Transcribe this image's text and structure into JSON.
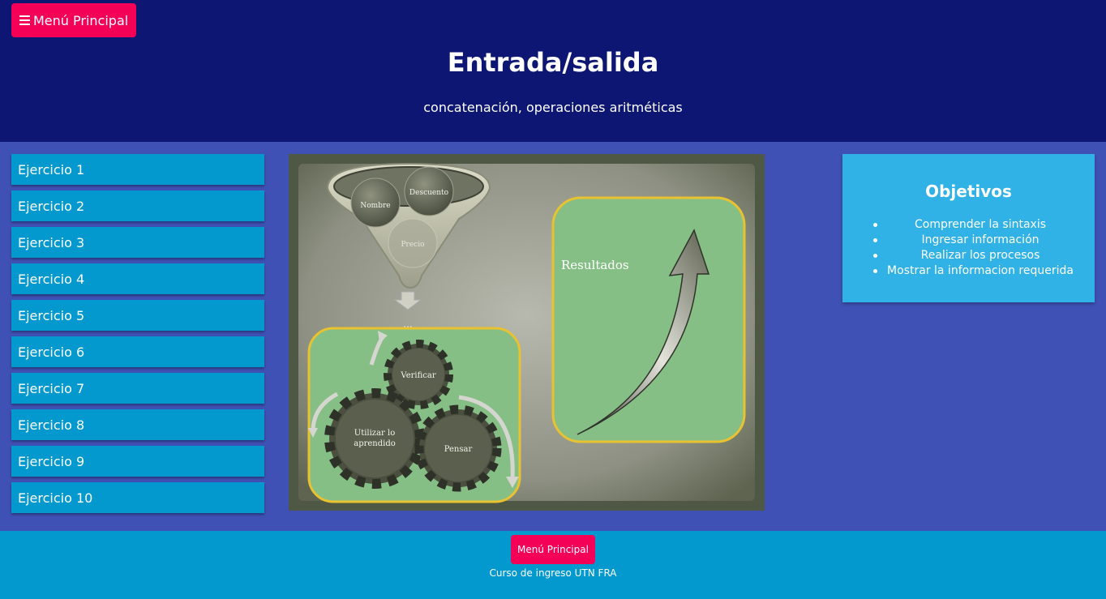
{
  "header": {
    "menu_label": "Menú Principal",
    "title": "Entrada/salida",
    "subtitle": "concatenación, operaciones aritméticas"
  },
  "sidebar": {
    "items": [
      {
        "label": "Ejercicio 1"
      },
      {
        "label": "Ejercicio 2"
      },
      {
        "label": "Ejercicio 3"
      },
      {
        "label": "Ejercicio 4"
      },
      {
        "label": "Ejercicio 5"
      },
      {
        "label": "Ejercicio 6"
      },
      {
        "label": "Ejercicio 7"
      },
      {
        "label": "Ejercicio 8"
      },
      {
        "label": "Ejercicio 9"
      },
      {
        "label": "Ejercicio 10"
      }
    ]
  },
  "diagram": {
    "inputs": [
      "Nombre",
      "Descuento",
      "Precio"
    ],
    "gears": [
      "Verificar",
      "Utilizar lo aprendido",
      "Pensar"
    ],
    "gear_lines": [
      "Utilizar lo",
      "aprendido"
    ],
    "result": "Resultados",
    "ellipsis": "..."
  },
  "objectives": {
    "title": "Objetivos",
    "items": [
      "Comprender la sintaxis",
      "Ingresar información",
      "Realizar los procesos",
      "Mostrar la informacion requerida"
    ]
  },
  "footer": {
    "button_label": "Menú Principal",
    "caption": "Curso de ingreso UTN FRA"
  },
  "colors": {
    "header_bg": "#0d1673",
    "main_bg": "#3f51b5",
    "accent_pink": "#f50057",
    "item_blue": "#0399cf",
    "objectives_bg": "#31b2e6",
    "green_box": "#86bf86",
    "yellow_border": "#e8c230"
  },
  "icons": [
    "hamburger-icon"
  ]
}
